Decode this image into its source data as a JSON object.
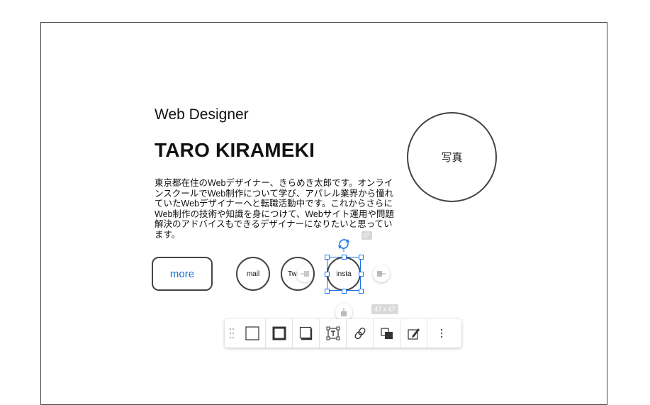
{
  "profile": {
    "subtitle": "Web Designer",
    "name": "TARO KIRAMEKI",
    "bio": "東京都在住のWebデザイナー、きらめき太郎です。オンラインスクールでWeb制作について学び、アパレル業界から憧れていたWebデザイナーへと転職活動中です。これからさらにWeb制作の技術や知識を身につけて、Webサイト運用や問題解決のアドバイスもできるデザイナーになりたいと思っています。",
    "photo_label": "写真",
    "more_label": "more"
  },
  "sns": {
    "mail": "mail",
    "twitter": "Twi",
    "insta": "insta"
  },
  "selection": {
    "angle": "0°",
    "size": "47 x 47"
  },
  "colors": {
    "accent": "#1a73e8",
    "link": "#1a6fd0",
    "border": "#444444"
  },
  "toolbar": {
    "items": [
      "drag-handle-icon",
      "fill-icon",
      "border-icon",
      "shadow-icon",
      "text-box-icon",
      "link-icon",
      "arrange-icon",
      "edit-style-icon",
      "more-options-icon"
    ]
  }
}
